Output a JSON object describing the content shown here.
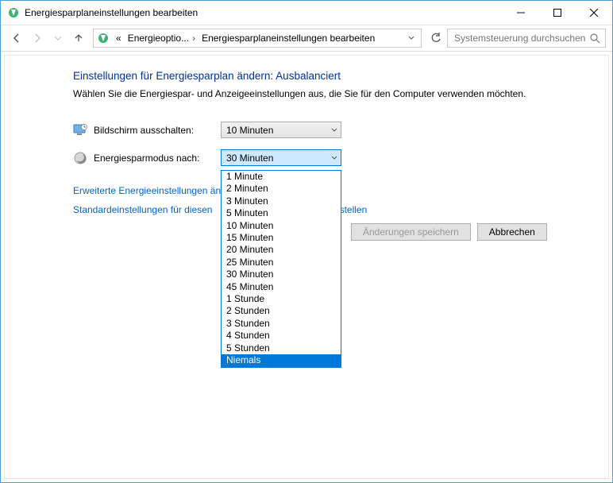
{
  "titlebar": {
    "title": "Energiesparplaneinstellungen bearbeiten"
  },
  "nav": {
    "breadcrumb": {
      "prefix": "«",
      "seg1": "Energieoptio...",
      "seg2": "Energiesparplaneinstellungen bearbeiten"
    },
    "search_placeholder": "Systemsteuerung durchsuchen"
  },
  "page": {
    "heading": "Einstellungen für Energiesparplan ändern: Ausbalanciert",
    "description": "Wählen Sie die Energiespar- und Anzeigeeinstellungen aus, die Sie für den Computer verwenden möchten.",
    "row1_label": "Bildschirm ausschalten:",
    "row1_value": "10 Minuten",
    "row2_label": "Energiesparmodus nach:",
    "row2_value": "30 Minuten",
    "link1": "Erweiterte Energieeinstellungen ändern",
    "link2_a": "Standardeinstellungen für diesen",
    "link2_b": "stellen",
    "btn_save": "Änderungen speichern",
    "btn_cancel": "Abbrechen"
  },
  "dropdown": {
    "options": [
      "1 Minute",
      "2 Minuten",
      "3 Minuten",
      "5 Minuten",
      "10 Minuten",
      "15 Minuten",
      "20 Minuten",
      "25 Minuten",
      "30 Minuten",
      "45 Minuten",
      "1 Stunde",
      "2 Stunden",
      "3 Stunden",
      "4 Stunden",
      "5 Stunden",
      "Niemals"
    ],
    "highlighted_index": 15
  }
}
